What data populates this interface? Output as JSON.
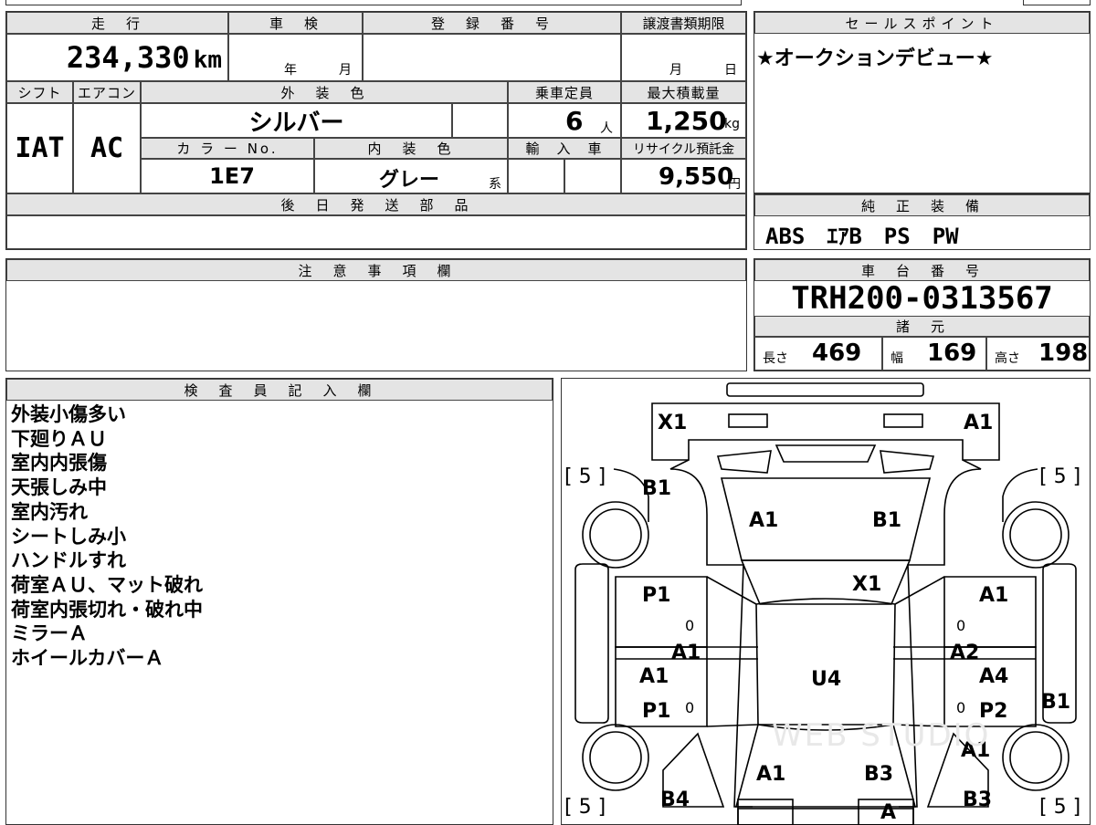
{
  "top": {
    "mileage_label": "走　行",
    "mileage_value": "234,330",
    "mileage_unit": "km",
    "inspection_label": "車　検",
    "inspection_year_unit": "年",
    "inspection_month_unit": "月",
    "registration_label": "登　録　番　号",
    "deadline_label": "譲渡書類期限",
    "deadline_month_unit": "月",
    "deadline_day_unit": "日"
  },
  "specs": {
    "shift_label": "シフト",
    "shift_value": "IAT",
    "ac_label": "エアコン",
    "ac_value": "AC",
    "exterior_color_label": "外　装　色",
    "exterior_color_value": "シルバー",
    "capacity_label": "乗車定員",
    "capacity_value": "6",
    "capacity_unit": "人",
    "max_load_label": "最大積載量",
    "max_load_value": "1,250",
    "max_load_unit": "kg",
    "color_no_label": "カ ラ ー No.",
    "color_no_value": "1E7",
    "interior_color_label": "内　装　色",
    "interior_color_value": "グレー",
    "interior_color_suffix": "系",
    "import_label": "輸　入　車",
    "recycle_label": "リサイクル預託金",
    "recycle_value": "9,550",
    "recycle_unit": "円",
    "later_shipping_label": "後　日　発　送　部　品"
  },
  "sales": {
    "label": "セールスポイント",
    "text": "★オークションデビュー★"
  },
  "genuine": {
    "label": "純　正　装　備",
    "text": "ABS　ｴｱB　PS　PW"
  },
  "notes": {
    "label": "注　意　事　項　欄"
  },
  "chassis": {
    "label": "車　台　番　号",
    "value": "TRH200-0313567",
    "dims_label": "諸　元",
    "length_label": "長さ",
    "length_value": "469",
    "width_label": "幅",
    "width_value": "169",
    "height_label": "高さ",
    "height_value": "198"
  },
  "inspector": {
    "label": "検　査　員　記　入　欄",
    "lines": [
      "外装小傷多い",
      "下廻りＡＵ",
      "室内内張傷",
      "天張しみ中",
      "室内汚れ",
      "シートしみ小",
      "ハンドルすれ",
      "荷室ＡＵ、マット破れ",
      "荷室内張切れ・破れ中",
      "ミラーＡ",
      "ホイールカバーＡ"
    ]
  },
  "diagram": {
    "marks": {
      "x1_tl": "X1",
      "a1_tr": "A1",
      "tread_tl": "[ 5 ]",
      "tread_tr": "[ 5 ]",
      "tread_bl": "[ 5 ]",
      "tread_br": "[ 5 ]",
      "b1_l": "B1",
      "a1_hood": "A1",
      "b1_hood": "B1",
      "p1_ul": "P1",
      "x1_roof": "X1",
      "a1_ur": "A1",
      "zero_ul": "0",
      "zero_ur": "0",
      "a1_mid_l": "A1",
      "a2_mid_r": "A2",
      "a1_ll": "A1",
      "u4": "U4",
      "a4_lr": "A4",
      "p1_ll": "P1",
      "zero_ll": "0",
      "zero_lr": "0",
      "p2_lr": "P2",
      "b1_side_r": "B1",
      "a1_rr": "A1",
      "a1_tail_l": "A1",
      "b3_tail_r": "B3",
      "b4_bl": "B4",
      "b3_br": "B3",
      "a_bottom": "A"
    },
    "watermark": "WEB STUDIO"
  }
}
